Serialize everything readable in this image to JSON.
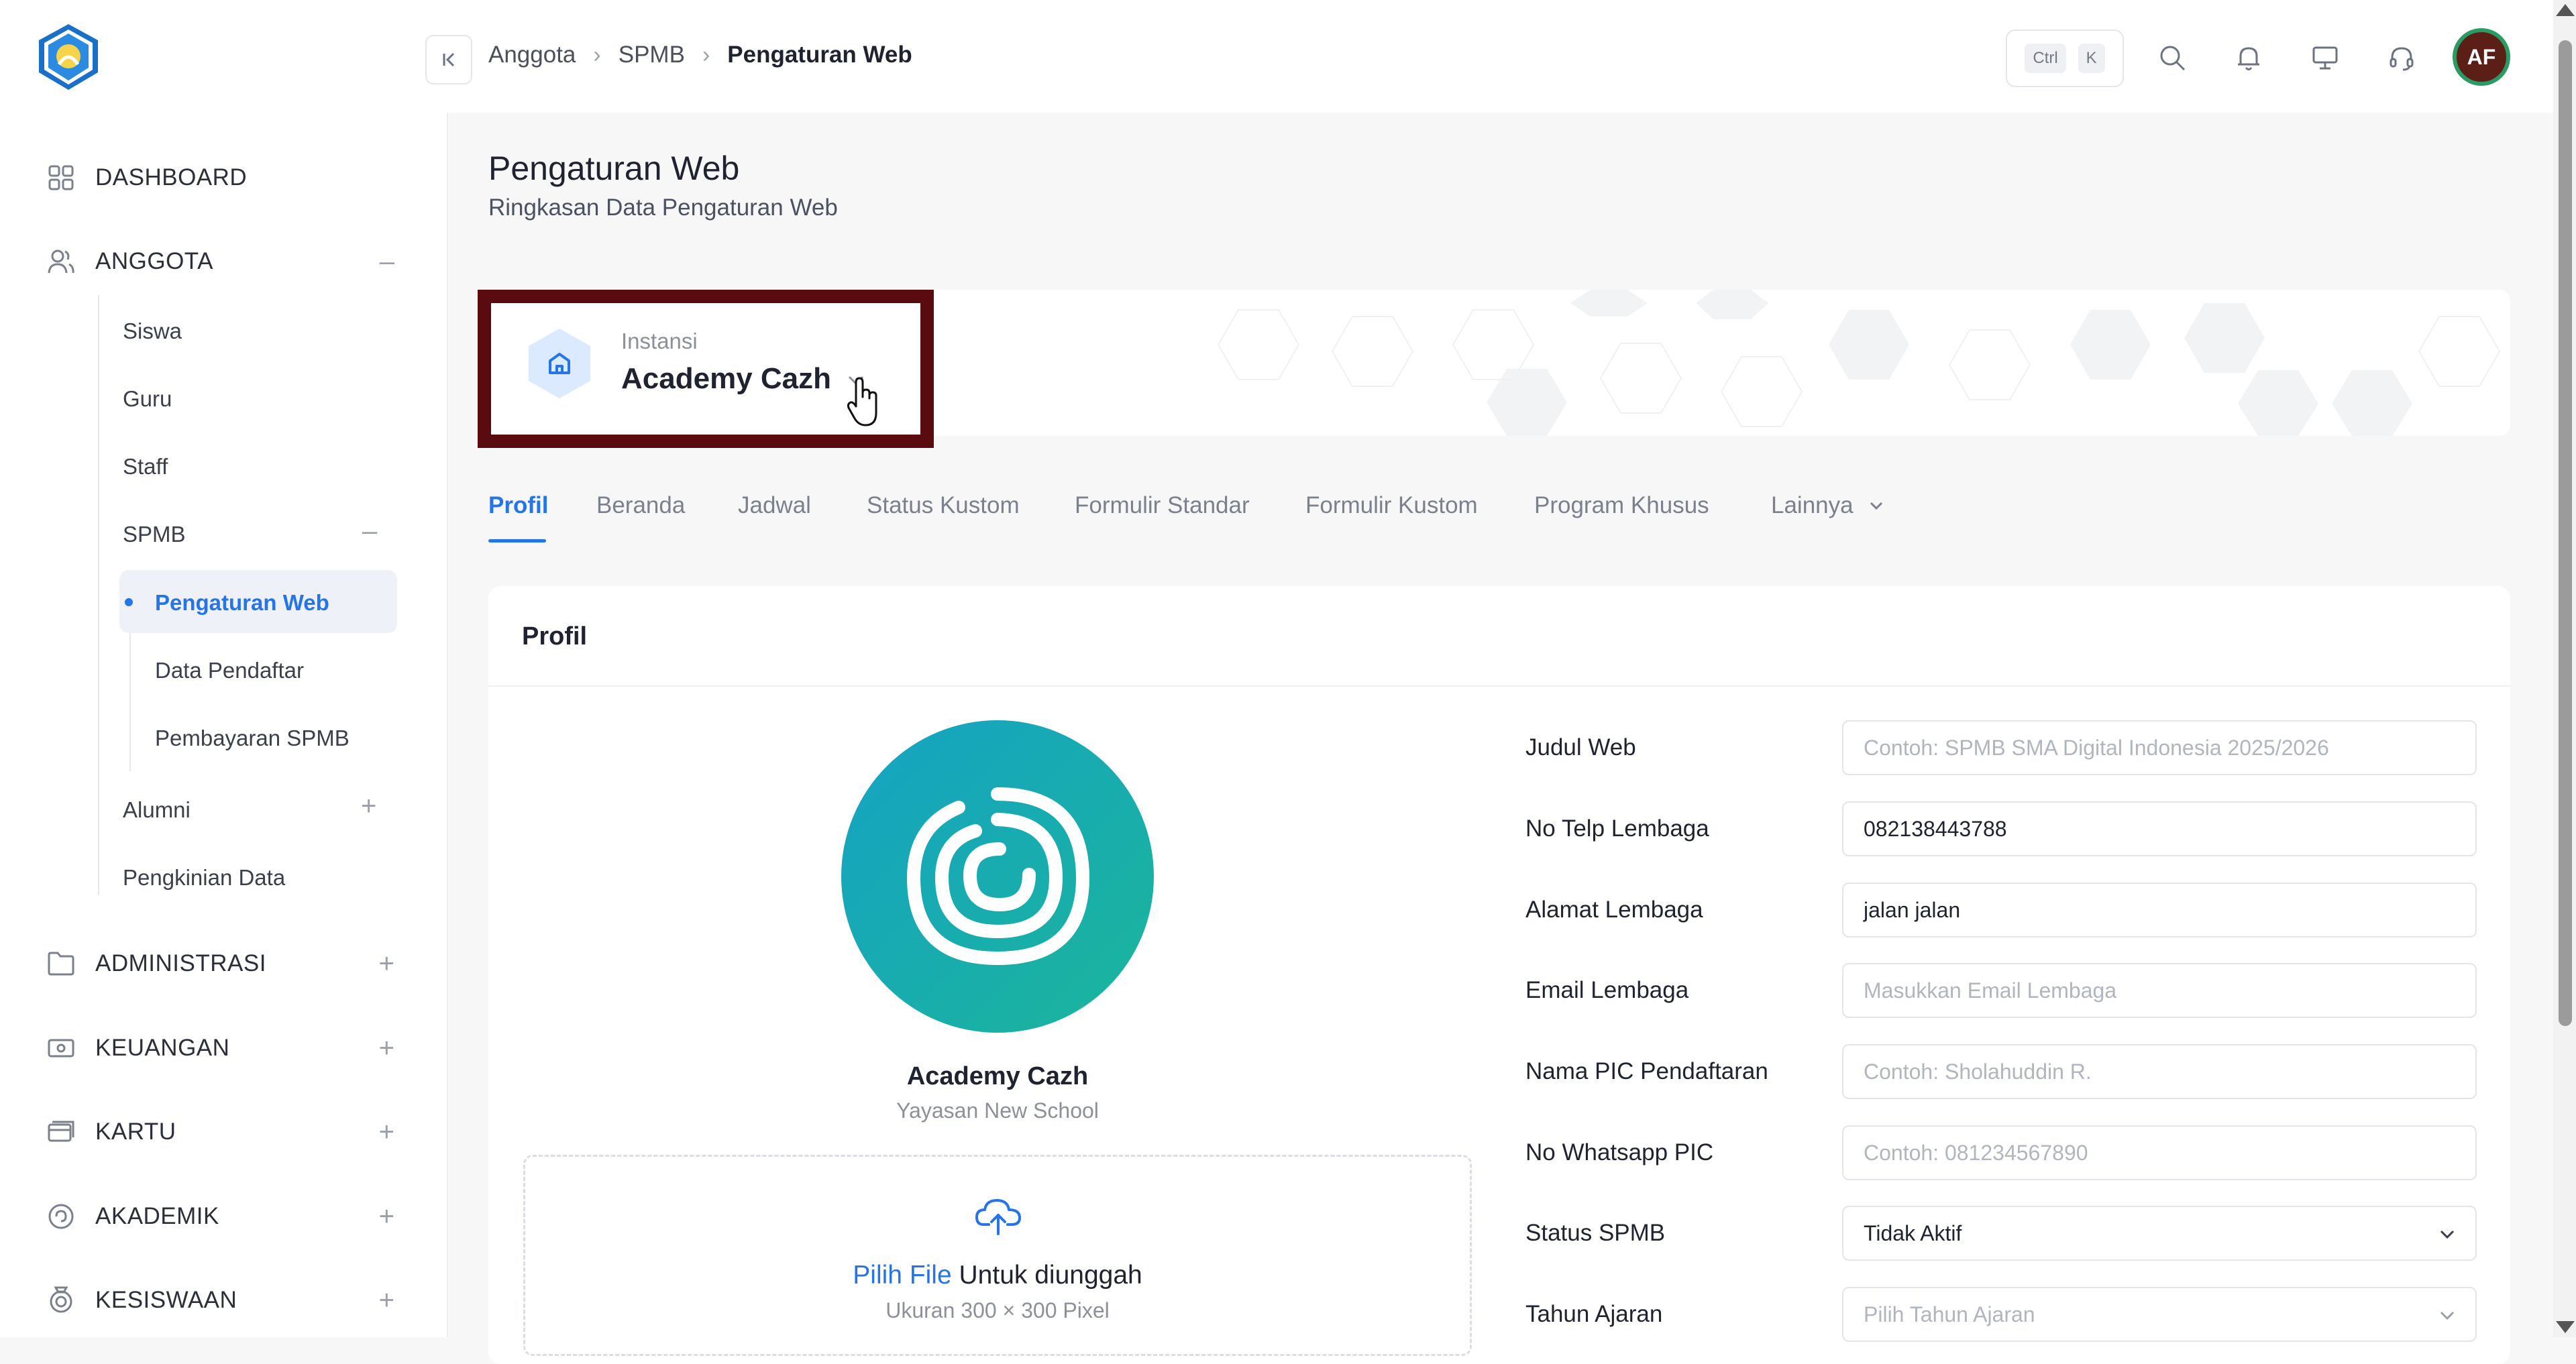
{
  "breadcrumb": [
    "Anggota",
    "SPMB",
    "Pengaturan Web"
  ],
  "topbar": {
    "kbd_ctrl": "Ctrl",
    "kbd_k": "K",
    "avatar_initials": "AF"
  },
  "sidebar": {
    "dashboard": "DASHBOARD",
    "anggota": "ANGGOTA",
    "anggota_sub": {
      "siswa": "Siswa",
      "guru": "Guru",
      "staff": "Staff",
      "spmb": "SPMB",
      "alumni": "Alumni",
      "pengkinian": "Pengkinian Data"
    },
    "spmb_sub": {
      "pengaturan_web": "Pengaturan Web",
      "data_pendaftar": "Data Pendaftar",
      "pembayaran": "Pembayaran SPMB"
    },
    "administrasi": "ADMINISTRASI",
    "keuangan": "KEUANGAN",
    "kartu": "KARTU",
    "akademik": "AKADEMIK",
    "kesiswaan": "KESISWAAN"
  },
  "page": {
    "title": "Pengaturan Web",
    "subtitle": "Ringkasan Data Pengaturan Web"
  },
  "instansi": {
    "label": "Instansi",
    "value": "Academy Cazh"
  },
  "tabs": [
    "Profil",
    "Beranda",
    "Jadwal",
    "Status Kustom",
    "Formulir Standar",
    "Formulir Kustom",
    "Program Khusus",
    "Lainnya"
  ],
  "profil": {
    "heading": "Profil",
    "school_name": "Academy Cazh",
    "foundation": "Yayasan New School",
    "upload_link": "Pilih File",
    "upload_text": "Untuk diunggah",
    "upload_size": "Ukuran 300 × 300 Pixel"
  },
  "form": {
    "judul_web": {
      "label": "Judul Web",
      "placeholder": "Contoh: SPMB SMA Digital Indonesia 2025/2026"
    },
    "no_telp": {
      "label": "No Telp Lembaga",
      "value": "082138443788"
    },
    "alamat": {
      "label": "Alamat Lembaga",
      "value": "jalan jalan"
    },
    "email": {
      "label": "Email Lembaga",
      "placeholder": "Masukkan Email Lembaga"
    },
    "pic": {
      "label": "Nama PIC Pendaftaran",
      "placeholder": "Contoh: Sholahuddin R."
    },
    "wa_pic": {
      "label": "No Whatsapp PIC",
      "placeholder": "Contoh: 081234567890"
    },
    "status": {
      "label": "Status SPMB",
      "value": "Tidak Aktif"
    },
    "tahun": {
      "label": "Tahun Ajaran",
      "placeholder": "Pilih Tahun Ajaran"
    }
  },
  "colors": {
    "accent": "#2574e8",
    "highlight_border": "#5a0b10",
    "logo_teal_start": "#15a3c4",
    "logo_teal_end": "#1bb59a",
    "avatar_bg": "#5b1f17",
    "avatar_ring": "#2a9b63"
  }
}
